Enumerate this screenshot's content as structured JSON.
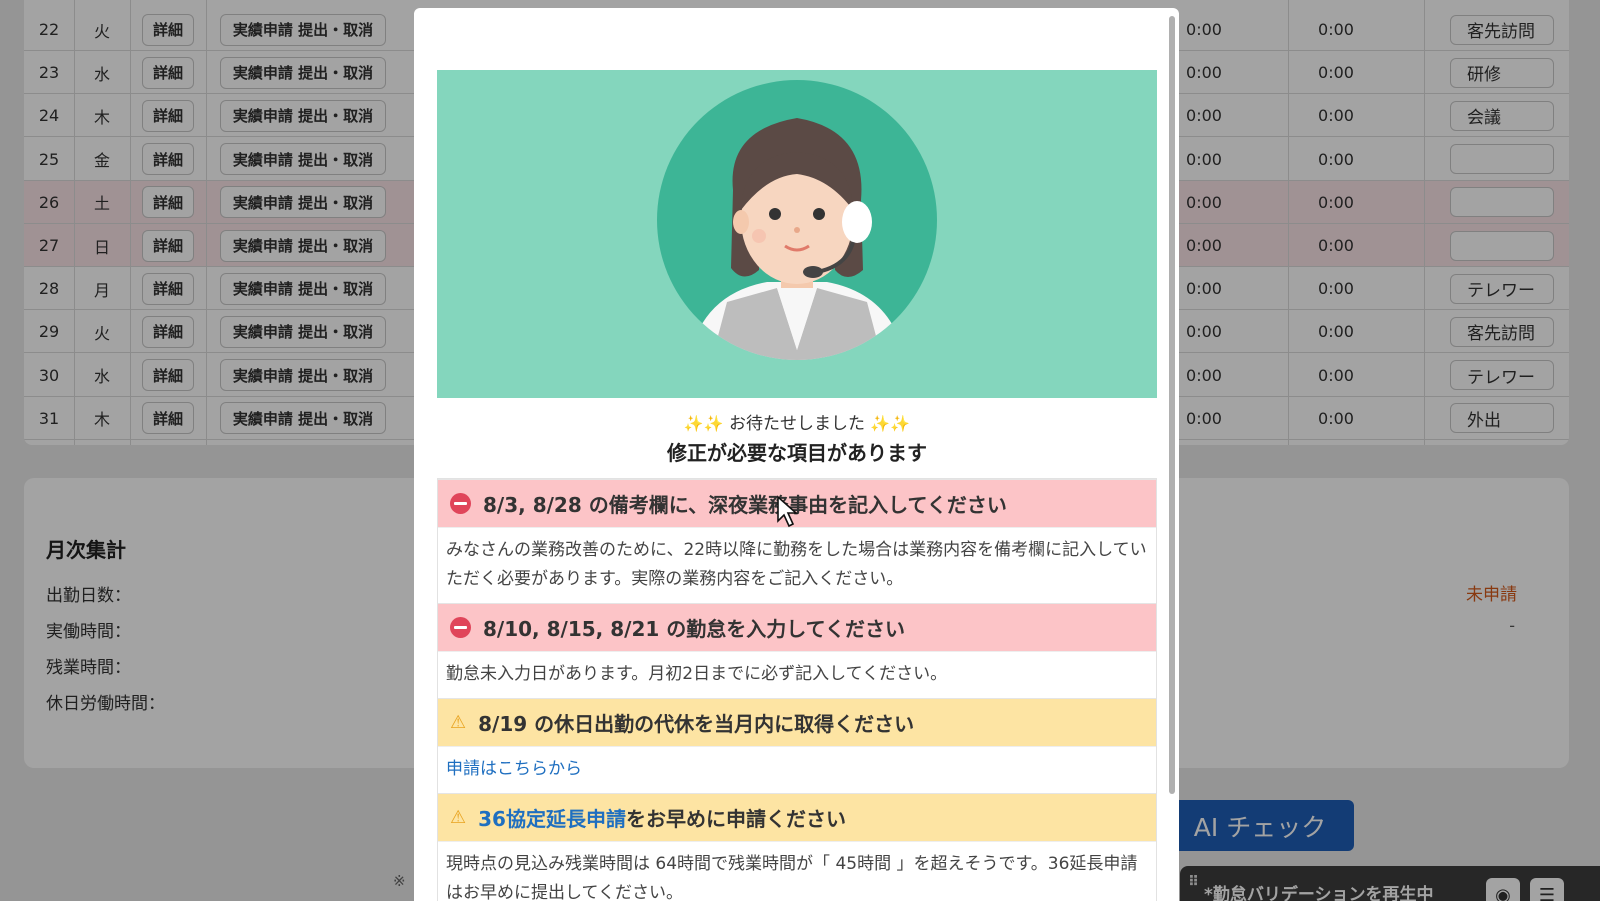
{
  "rows": [
    {
      "day": "22",
      "weekday": "火",
      "detail": "詳細",
      "action": "実績申請 提出・取消",
      "time1": "0:00",
      "time2": "0:00",
      "note": "客先訪問",
      "weekend": false
    },
    {
      "day": "23",
      "weekday": "水",
      "detail": "詳細",
      "action": "実績申請 提出・取消",
      "time1": "0:00",
      "time2": "0:00",
      "note": "研修",
      "weekend": false
    },
    {
      "day": "24",
      "weekday": "木",
      "detail": "詳細",
      "action": "実績申請 提出・取消",
      "time1": "0:00",
      "time2": "0:00",
      "note": "会議",
      "weekend": false
    },
    {
      "day": "25",
      "weekday": "金",
      "detail": "詳細",
      "action": "実績申請 提出・取消",
      "time1": "0:00",
      "time2": "0:00",
      "note": "",
      "weekend": false
    },
    {
      "day": "26",
      "weekday": "土",
      "detail": "詳細",
      "action": "実績申請 提出・取消",
      "time1": "0:00",
      "time2": "0:00",
      "note": "",
      "weekend": true
    },
    {
      "day": "27",
      "weekday": "日",
      "detail": "詳細",
      "action": "実績申請 提出・取消",
      "time1": "0:00",
      "time2": "0:00",
      "note": "",
      "weekend": true
    },
    {
      "day": "28",
      "weekday": "月",
      "detail": "詳細",
      "action": "実績申請 提出・取消",
      "time1": "0:00",
      "time2": "0:00",
      "note": "テレワー",
      "weekend": false
    },
    {
      "day": "29",
      "weekday": "火",
      "detail": "詳細",
      "action": "実績申請 提出・取消",
      "time1": "0:00",
      "time2": "0:00",
      "note": "客先訪問",
      "weekend": false
    },
    {
      "day": "30",
      "weekday": "水",
      "detail": "詳細",
      "action": "実績申請 提出・取消",
      "time1": "0:00",
      "time2": "0:00",
      "note": "テレワー",
      "weekend": false
    },
    {
      "day": "31",
      "weekday": "木",
      "detail": "詳細",
      "action": "実績申請 提出・取消",
      "time1": "0:00",
      "time2": "0:00",
      "note": "外出",
      "weekend": false
    }
  ],
  "summary": {
    "title": "月次集計",
    "workdays_label": "出勤日数：",
    "actual_hours_label": "実働時間：",
    "overtime_label": "残業時間：",
    "holiday_work_label": "休日労働時間：",
    "status": "未申請",
    "dash": "-"
  },
  "ai_check_label": "AI チェック",
  "footnote_mark": "※",
  "bottom_bar": {
    "text": "*勤怠バリデーションを再生中",
    "grip": "⠿"
  },
  "modal": {
    "sparkles_left": "✨✨",
    "sparkles_right": "✨✨",
    "wait_text": "お待たせしました",
    "heading": "修正が必要な項目があります",
    "issues": [
      {
        "title": "8/3, 8/28 の備考欄に、深夜業務事由を記入してください",
        "body": "みなさんの業務改善のために、22時以降に勤務をした場合は業務内容を備考欄に記入していただく必要があります。実際の業務内容をご記入ください。"
      },
      {
        "title": "8/10, 8/15, 8/21 の勤怠を入力してください",
        "body": "勤怠未入力日があります。月初2日までに必ず記入してください。"
      },
      {
        "title": "8/19 の休日出勤の代休を当月内に取得ください",
        "link": "申請はこちらから"
      },
      {
        "title_link": "36協定延長申請",
        "title_rest": "をお早めに申請ください",
        "body": "現時点の見込み残業時間は 64時間で残業時間が「 45時間 」を超えそうです。36延長申請はお早めに提出してください。"
      }
    ]
  },
  "colors": {
    "error_bg": "#fcc4c7",
    "warn_bg": "#fde4a3",
    "hero_bg": "#84d6bd",
    "accent_blue": "#1e5fb8",
    "status_orange": "#d55a1a"
  }
}
